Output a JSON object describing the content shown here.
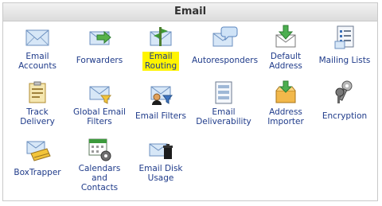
{
  "panel": {
    "title": "Email"
  },
  "items": [
    {
      "label": "Email Accounts",
      "icon": "envelope-icon"
    },
    {
      "label": "Forwarders",
      "icon": "forward-arrow-envelope-icon"
    },
    {
      "label": "Email Routing",
      "icon": "routing-sign-envelope-icon",
      "highlight": "#fff400"
    },
    {
      "label": "Autoresponders",
      "icon": "speech-bubble-envelope-icon"
    },
    {
      "label": "Default Address",
      "icon": "download-envelope-icon"
    },
    {
      "label": "Mailing Lists",
      "icon": "list-document-icon"
    },
    {
      "label": "Track Delivery",
      "icon": "package-clipboard-icon"
    },
    {
      "label": "Global Email Filters",
      "icon": "global-filter-envelope-icon"
    },
    {
      "label": "Email Filters",
      "icon": "user-filter-envelope-icon"
    },
    {
      "label": "Email Deliverability",
      "icon": "server-list-icon"
    },
    {
      "label": "Address Importer",
      "icon": "import-box-icon"
    },
    {
      "label": "Encryption",
      "icon": "keys-icon"
    },
    {
      "label": "BoxTrapper",
      "icon": "trap-envelope-icon"
    },
    {
      "label": "Calendars and Contacts",
      "icon": "calendar-gear-icon"
    },
    {
      "label": "Email Disk Usage",
      "icon": "trash-envelope-icon"
    }
  ]
}
